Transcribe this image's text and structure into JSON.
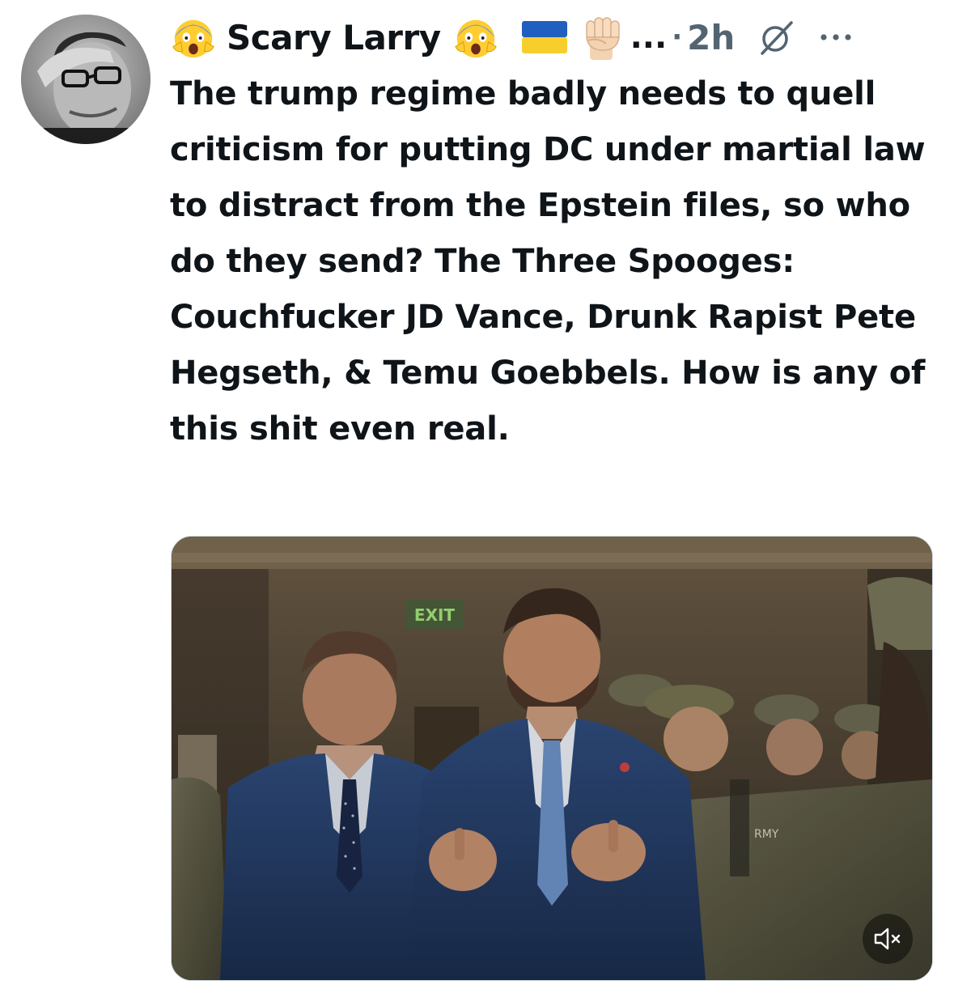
{
  "tweet": {
    "author": {
      "display_name": "Scary Larry",
      "leading_emoji": "scream-emoji",
      "trailing_emoji": "scream-emoji",
      "flag": "ukraine-flag",
      "fist": "raised-fist-emoji",
      "truncation": "...",
      "separator": "·",
      "time_ago": "2h"
    },
    "text": "The trump regime badly needs to quell criticism for putting DC under martial law to distract from the Epstein files, so who do they send? The Three Spooges: Couchfucker JD Vance, Drunk Rapist Pete Hegseth, & Temu Goebbels. How is any of this shit even real.",
    "media": {
      "type": "video",
      "exit_sign": "EXIT",
      "patch_text": "RMY",
      "muted": true
    },
    "icons": {
      "grok": "grok-icon",
      "more": "more-icon",
      "mute": "speaker-muted-icon"
    },
    "colors": {
      "text": "#0f1419",
      "secondary": "#536471",
      "border": "#cfd9de"
    }
  }
}
